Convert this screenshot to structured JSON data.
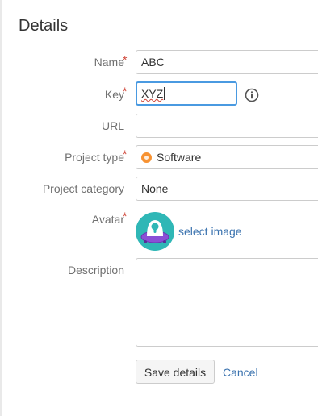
{
  "page": {
    "title": "Details"
  },
  "form": {
    "name": {
      "label": "Name",
      "value": "ABC",
      "required": true
    },
    "key": {
      "label": "Key",
      "value": "XYZ",
      "required": true
    },
    "url": {
      "label": "URL",
      "value": ""
    },
    "project_type": {
      "label": "Project type",
      "value": "Software",
      "required": true
    },
    "project_category": {
      "label": "Project category",
      "value": "None"
    },
    "avatar": {
      "label": "Avatar",
      "link": "select image",
      "required": true
    },
    "description": {
      "label": "Description",
      "value": ""
    }
  },
  "actions": {
    "save": "Save details",
    "cancel": "Cancel"
  },
  "colors": {
    "required": "#d04437",
    "link": "#3b73af",
    "focus": "#4a9ae1",
    "software_icon": "#f79232",
    "avatar_bg": "#2fb7b6",
    "avatar_saucer": "#8a4fd6"
  }
}
